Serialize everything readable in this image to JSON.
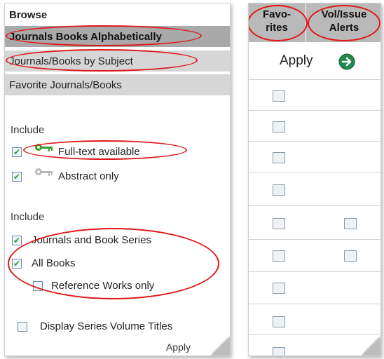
{
  "browse": {
    "title": "Browse",
    "nav": [
      {
        "label": "Journals Books Alphabetically"
      },
      {
        "label": "Journals/Books by Subject"
      },
      {
        "label": "Favorite Journals/Books"
      }
    ]
  },
  "include_access": {
    "label": "Include",
    "options": [
      {
        "label": "Full-text available",
        "checked": true,
        "icon": "key-icon-green"
      },
      {
        "label": "Abstract only",
        "checked": true,
        "icon": "key-icon-gray"
      }
    ]
  },
  "include_types": {
    "label": "Include",
    "options": [
      {
        "label": "Journals and Book Series",
        "checked": true
      },
      {
        "label": "All Books",
        "checked": true
      },
      {
        "label": "Reference Works only",
        "checked": false
      }
    ]
  },
  "display_series": {
    "label": "Display Series Volume Titles",
    "checked": false
  },
  "apply_left": {
    "label": "Apply"
  },
  "right_header": {
    "favorites_line1": "Favo-",
    "favorites_line2": "rites",
    "vol_line1": "Vol/Issue",
    "vol_line2": "Alerts"
  },
  "apply_right": {
    "label": "Apply",
    "icon": "arrow-right-icon"
  },
  "colors": {
    "accent_red": "#e01818",
    "check_green": "#2d9a34",
    "go_green": "#1f8a4c"
  }
}
